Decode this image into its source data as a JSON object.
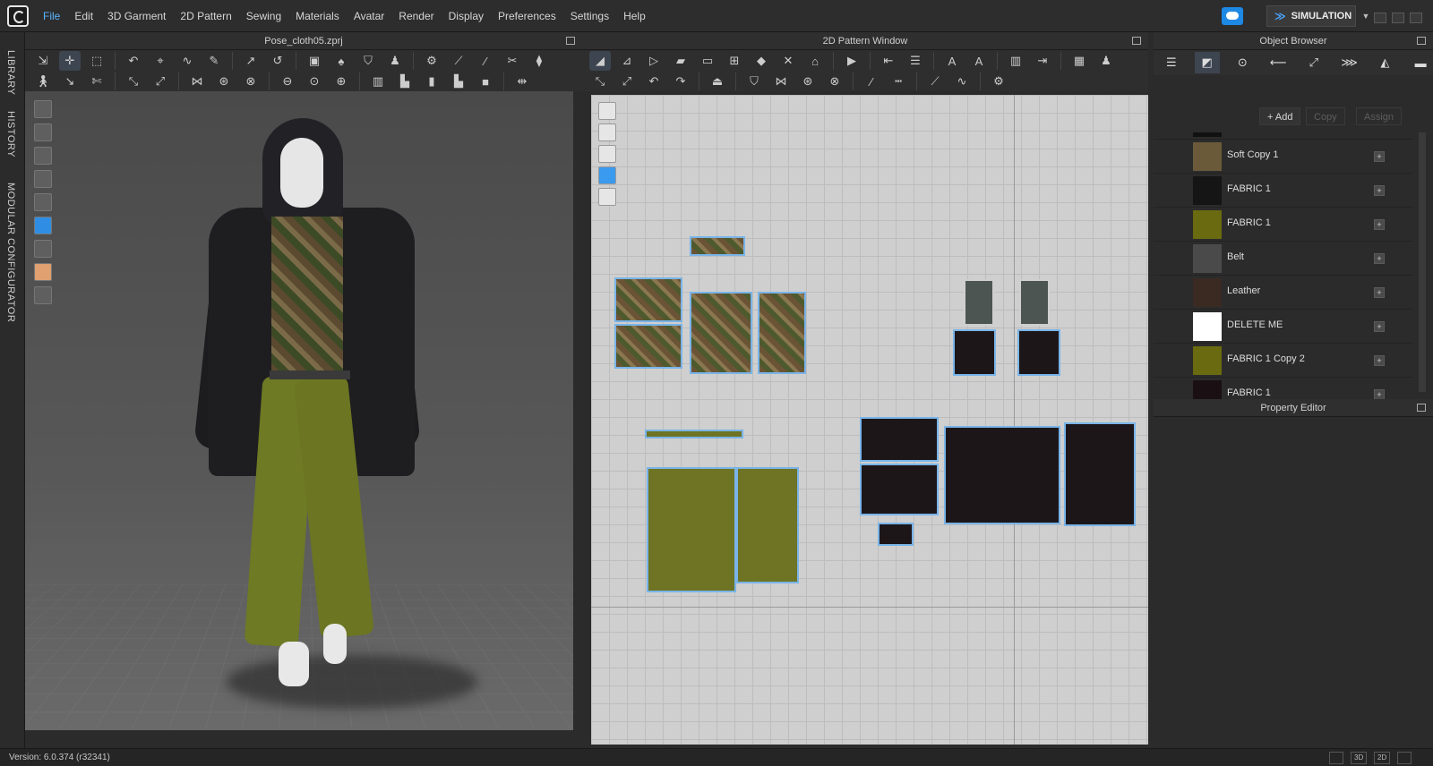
{
  "menu": [
    "File",
    "Edit",
    "3D Garment",
    "2D Pattern",
    "Sewing",
    "Materials",
    "Avatar",
    "Render",
    "Display",
    "Preferences",
    "Settings",
    "Help"
  ],
  "simulation_label": "SIMULATION",
  "side_tabs": [
    "LIBRARY",
    "HISTORY",
    "MODULAR CONFIGURATOR"
  ],
  "viewport3d_title": "Pose_cloth05.zprj",
  "pattern_window_title": "2D Pattern Window",
  "object_browser": {
    "title": "Object Browser",
    "add_label": "+ Add",
    "copy_label": "Copy",
    "assign_label": "Assign",
    "materials": [
      {
        "name": "",
        "color": "#111111"
      },
      {
        "name": "Soft Copy 1",
        "color": "#6b5a3a"
      },
      {
        "name": "FABRIC 1",
        "color": "#151515"
      },
      {
        "name": "FABRIC 1",
        "color": "#6a6a10"
      },
      {
        "name": "Belt",
        "color": "#4a4a4a"
      },
      {
        "name": "Leather",
        "color": "#3a2a22"
      },
      {
        "name": "DELETE ME",
        "color": "#ffffff"
      },
      {
        "name": "FABRIC 1 Copy 2",
        "color": "#6a6a10"
      },
      {
        "name": "FABRIC 1",
        "color": "#1a1014"
      }
    ]
  },
  "property_editor_title": "Property Editor",
  "status": {
    "version": "Version: 6.0.374 (r32341)",
    "view_3d": "3D",
    "view_2d": "2D"
  }
}
